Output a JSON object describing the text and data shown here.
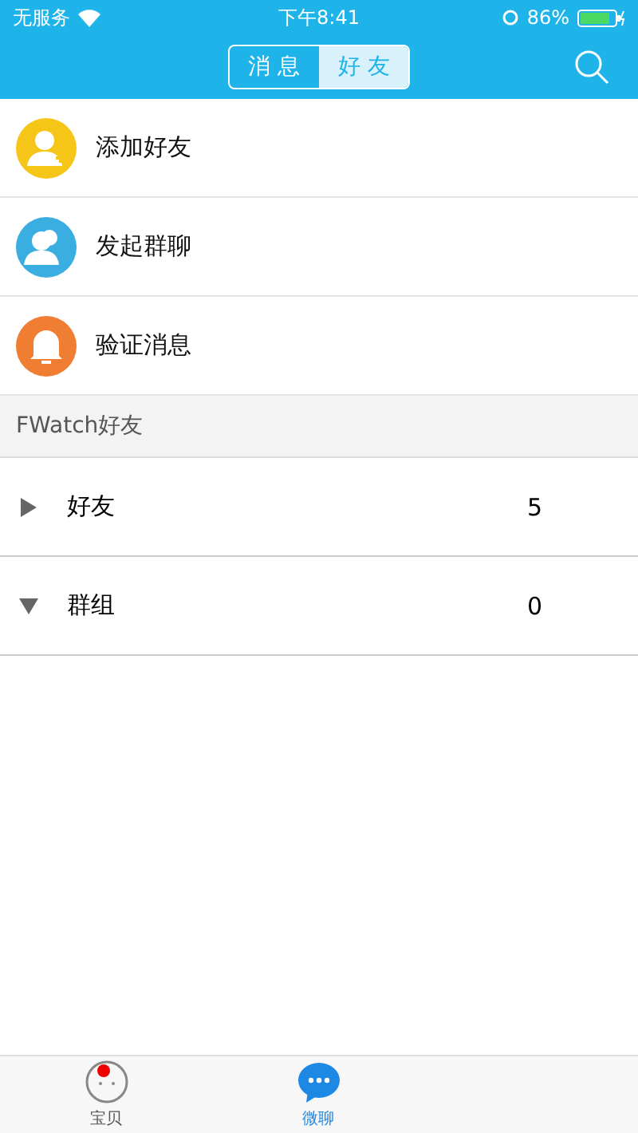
{
  "status_bar": {
    "carrier": "无服务",
    "time": "下午8:41",
    "battery": "86%"
  },
  "nav": {
    "segments": [
      {
        "label": "消 息",
        "selected": false
      },
      {
        "label": "好 友",
        "selected": true
      }
    ]
  },
  "actions": [
    {
      "label": "添加好友",
      "kind": "add",
      "color": "#f5c518"
    },
    {
      "label": "发起群聊",
      "kind": "group",
      "color": "#3aaee0"
    },
    {
      "label": "验证消息",
      "kind": "bell",
      "color": "#ef7d32"
    }
  ],
  "section_title": "FWatch好友",
  "groups": [
    {
      "name": "好友",
      "count": "5",
      "expanded": false
    },
    {
      "name": "群组",
      "count": "0",
      "expanded": true
    }
  ],
  "tab_bar": [
    {
      "label": "宝贝",
      "kind": "face",
      "selected": false,
      "badge": true
    },
    {
      "label": "微聊",
      "kind": "chat",
      "selected": true,
      "badge": false
    }
  ]
}
